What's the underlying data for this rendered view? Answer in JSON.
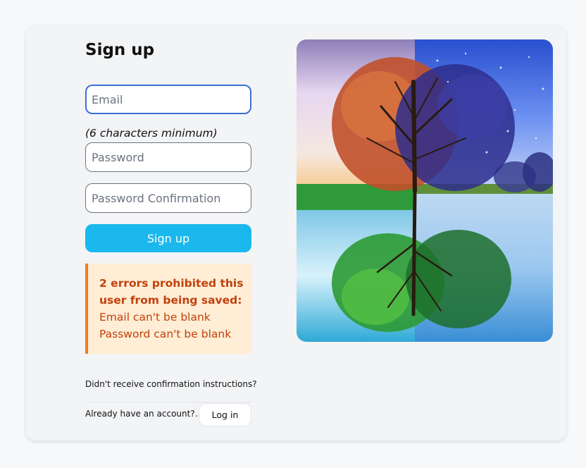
{
  "page": {
    "title": "Sign up"
  },
  "form": {
    "email_placeholder": "Email",
    "password_hint": "(6 characters minimum)",
    "password_placeholder": "Password",
    "password_confirmation_placeholder": "Password Confirmation",
    "submit_label": "Sign up"
  },
  "errors": {
    "title": "2 errors prohibited this user from being saved:",
    "messages": [
      "Email can't be blank",
      "Password can't be blank"
    ]
  },
  "links": {
    "confirmation": "Didn't receive confirmation instructions?",
    "already_have_account": "Already have an account?...",
    "login_label": "Log in"
  },
  "hero_image": {
    "icon": "four-seasons-tree-image"
  },
  "colors": {
    "accent": "#1ab8ec",
    "focus_border": "#3b6fd6",
    "error_background": "#ffedd5",
    "error_border": "#f07b1c",
    "error_text": "#c2410c"
  }
}
